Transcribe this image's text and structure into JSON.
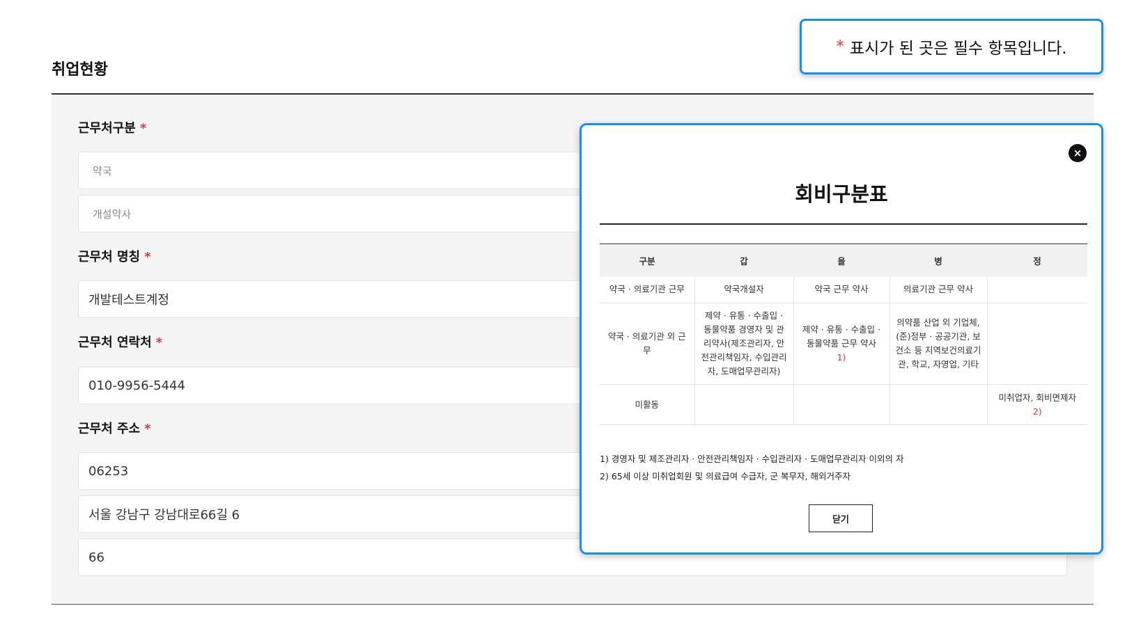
{
  "section": {
    "title": "취업현황"
  },
  "notice": {
    "star": "*",
    "text": "표시가 된 곳은 필수 항목입니다."
  },
  "form": {
    "required_mark": "*",
    "workplace_type": {
      "label": "근무처구분",
      "value1": "약국",
      "value2": "개설약사"
    },
    "workplace_name": {
      "label": "근무처 명칭",
      "value": "개발테스트계정"
    },
    "workplace_contact": {
      "label": "근무처 연락처",
      "value": "010-9956-5444"
    },
    "workplace_address": {
      "label": "근무처 주소",
      "zipcode": "06253",
      "address": "서울 강남구 강남대로66길 6",
      "detail": "66"
    }
  },
  "modal": {
    "title": "회비구분표",
    "close_icon": "×",
    "table": {
      "headers": [
        "구분",
        "갑",
        "을",
        "병",
        "정"
      ],
      "rows": [
        {
          "category": "약국 · 의료기관 근무",
          "gap": "약국개설자",
          "eul": "약국 근무 약사",
          "byeong": "의료기관 근무 약사",
          "jeong": ""
        },
        {
          "category": "약국 · 의료기관 외 근무",
          "gap": "제약 · 유통 · 수출입 · 동물약품 경영자 및 관리약사(제조관리자, 안전관리책임자, 수입관리자, 도매업무관리자)",
          "eul": "제약 · 유통 · 수출입 · 동물약품 근무 약사",
          "eul_note": "1)",
          "byeong": "의약품 산업 외 기업체, (준)정부 · 공공기관, 보건소 등 지역보건의료기관, 학교, 자영업, 기타",
          "jeong": ""
        },
        {
          "category": "미활동",
          "gap": "",
          "eul": "",
          "byeong": "",
          "jeong": "미취업자, 회비면제자",
          "jeong_note": "2)"
        }
      ]
    },
    "footnotes": [
      "1) 경영자 및 제조관리자 · 안전관리책임자 · 수입관리자 · 도매업무관리자 이외의 자",
      "2) 65세 이상 미취업회원 및 의료급여 수급자, 군 복무자, 해외거주자"
    ],
    "close_button": "닫기"
  },
  "colors": {
    "accent": "#1a8fe3",
    "required": "#e8333c",
    "panel": "#f4f4f4"
  }
}
